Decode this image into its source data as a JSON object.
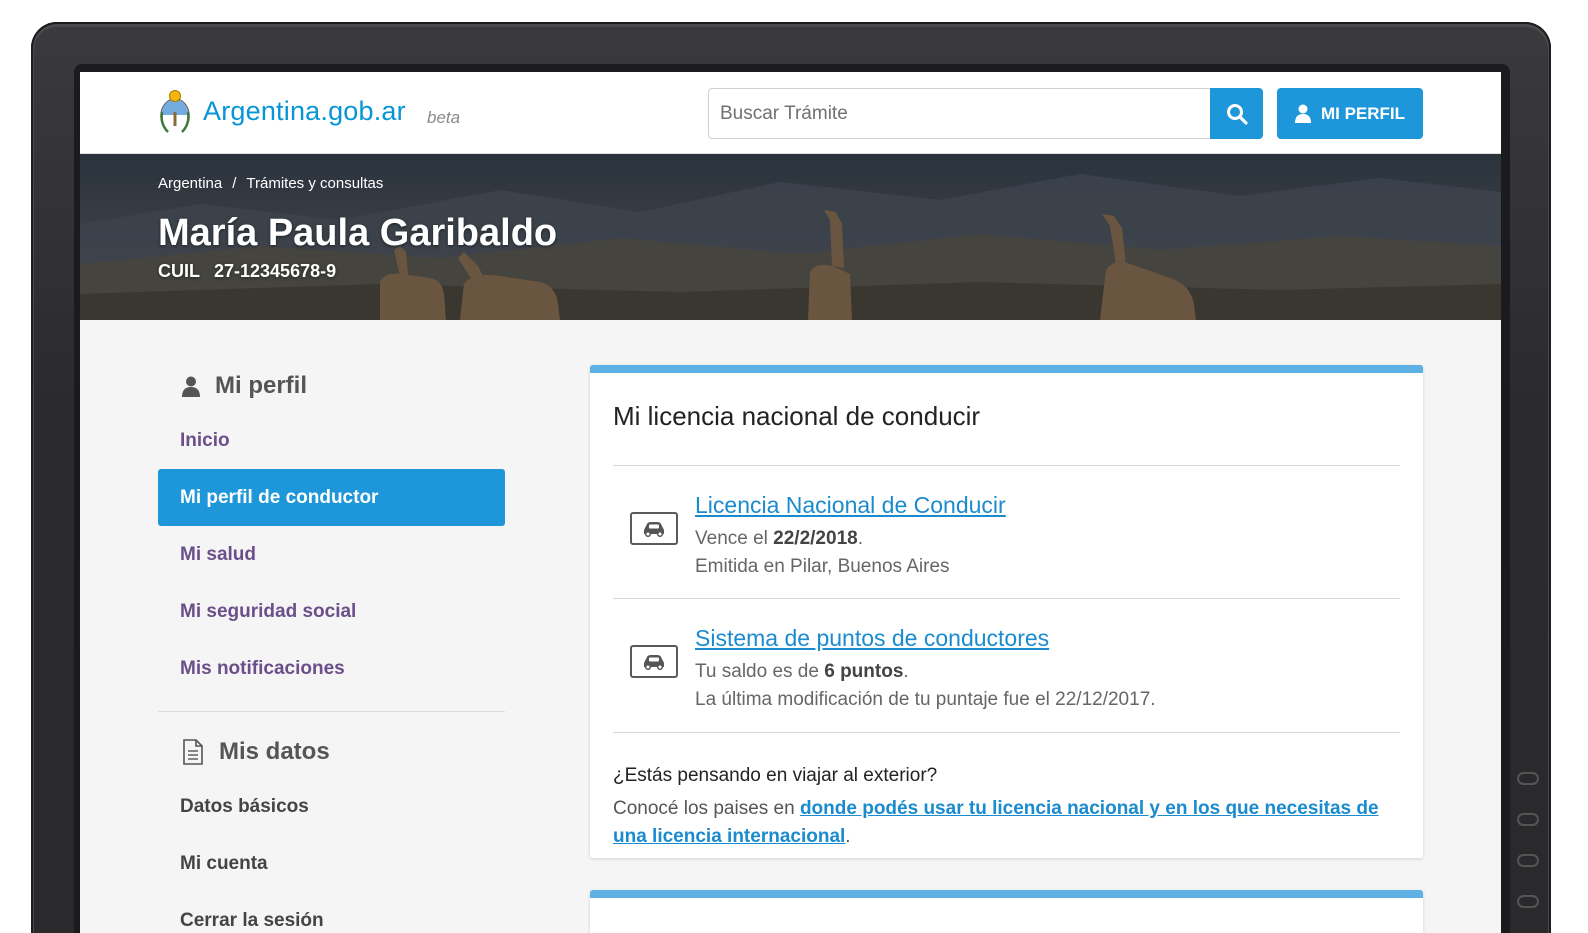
{
  "header": {
    "logo_text": "Argentina.gob.ar",
    "logo_badge": "beta",
    "search_placeholder": "Buscar Trámite",
    "profile_button": "MI PERFIL"
  },
  "hero": {
    "breadcrumb": [
      "Argentina",
      "Trámites y consultas"
    ],
    "breadcrumb_separator": "/",
    "name": "María Paula Garibaldo",
    "cuil_label": "CUIL",
    "cuil_value": "27-12345678-9"
  },
  "sidebar": {
    "profile_title": "Mi perfil",
    "profile_items": [
      {
        "label": "Inicio",
        "active": false
      },
      {
        "label": "Mi perfil de conductor",
        "active": true
      },
      {
        "label": "Mi salud",
        "active": false
      },
      {
        "label": "Mi seguridad social",
        "active": false
      },
      {
        "label": "Mis notificaciones",
        "active": false
      }
    ],
    "data_title": "Mis datos",
    "data_items": [
      {
        "label": "Datos básicos"
      },
      {
        "label": "Mi cuenta"
      },
      {
        "label": "Cerrar la sesión"
      }
    ]
  },
  "card": {
    "title": "Mi licencia nacional de conducir",
    "items": [
      {
        "icon": "car-icon",
        "link": "Licencia Nacional de Conducir",
        "line1_prefix": "Vence el ",
        "line1_bold": "22/2/2018",
        "line1_suffix": ".",
        "line2": "Emitida en Pilar, Buenos Aires"
      },
      {
        "icon": "car-icon",
        "link": "Sistema de puntos de conductores",
        "line1_prefix": "Tu saldo es de ",
        "line1_bold": "6 puntos",
        "line1_suffix": ".",
        "line2": "La última modificación de tu puntaje fue el 22/12/2017."
      }
    ],
    "travel_question": "¿Estás pensando en viajar al exterior?",
    "travel_prefix": "Conocé los paises en ",
    "travel_link": "donde podés usar tu licencia nacional y en los que necesitas de una licencia internacional",
    "travel_suffix": "."
  },
  "colors": {
    "brand_blue": "#1e97da",
    "card_accent": "#5eb1e4",
    "nav_purple": "#6b4f8a",
    "link_blue": "#1a8bcf"
  }
}
